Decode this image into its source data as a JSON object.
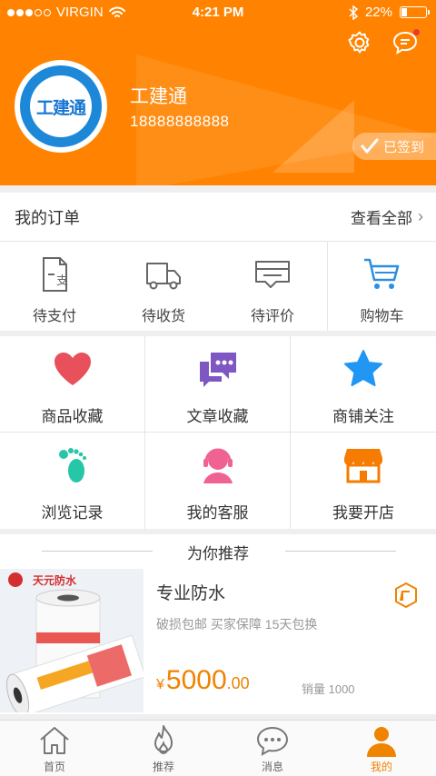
{
  "status_bar": {
    "carrier": "VIRGIN",
    "time": "4:21 PM",
    "battery": "22%",
    "battery_level": 0.22
  },
  "profile": {
    "avatar_text": "工建通",
    "name": "工建通",
    "phone": "18888888888",
    "signed_in_label": "已签到"
  },
  "orders": {
    "title": "我的订单",
    "view_all": "查看全部",
    "items": [
      {
        "label": "待支付",
        "icon": "payment-icon",
        "icon_text": "支"
      },
      {
        "label": "待收货",
        "icon": "truck-icon"
      },
      {
        "label": "待评价",
        "icon": "comment-icon"
      },
      {
        "label": "购物车",
        "icon": "cart-icon"
      }
    ]
  },
  "grid": {
    "items": [
      {
        "label": "商品收藏",
        "icon": "heart-icon",
        "color": "#e8505b"
      },
      {
        "label": "文章收藏",
        "icon": "chat-bubbles-icon",
        "color": "#7e57c2"
      },
      {
        "label": "商铺关注",
        "icon": "star-icon",
        "color": "#2196f3"
      },
      {
        "label": "浏览记录",
        "icon": "footprints-icon",
        "color": "#26c6a6"
      },
      {
        "label": "我的客服",
        "icon": "customer-service-icon",
        "color": "#f06292"
      },
      {
        "label": "我要开店",
        "icon": "shop-icon",
        "color": "#f57c00"
      }
    ]
  },
  "recommend": {
    "title": "为你推荐",
    "product": {
      "image_brand_text": "天元防水",
      "name": "专业防水",
      "tags": "破损包邮  买家保障  15天包换",
      "currency": "¥",
      "price_int": "5000",
      "price_dec": ".00",
      "sales": "销量 1000"
    }
  },
  "tabbar": {
    "items": [
      {
        "label": "首页",
        "icon": "home-icon",
        "active": false
      },
      {
        "label": "推荐",
        "icon": "fire-icon",
        "active": false
      },
      {
        "label": "消息",
        "icon": "message-icon",
        "active": false
      },
      {
        "label": "我的",
        "icon": "person-icon",
        "active": true
      }
    ]
  },
  "colors": {
    "brand_orange": "#ff8300",
    "price_orange": "#f08300"
  }
}
